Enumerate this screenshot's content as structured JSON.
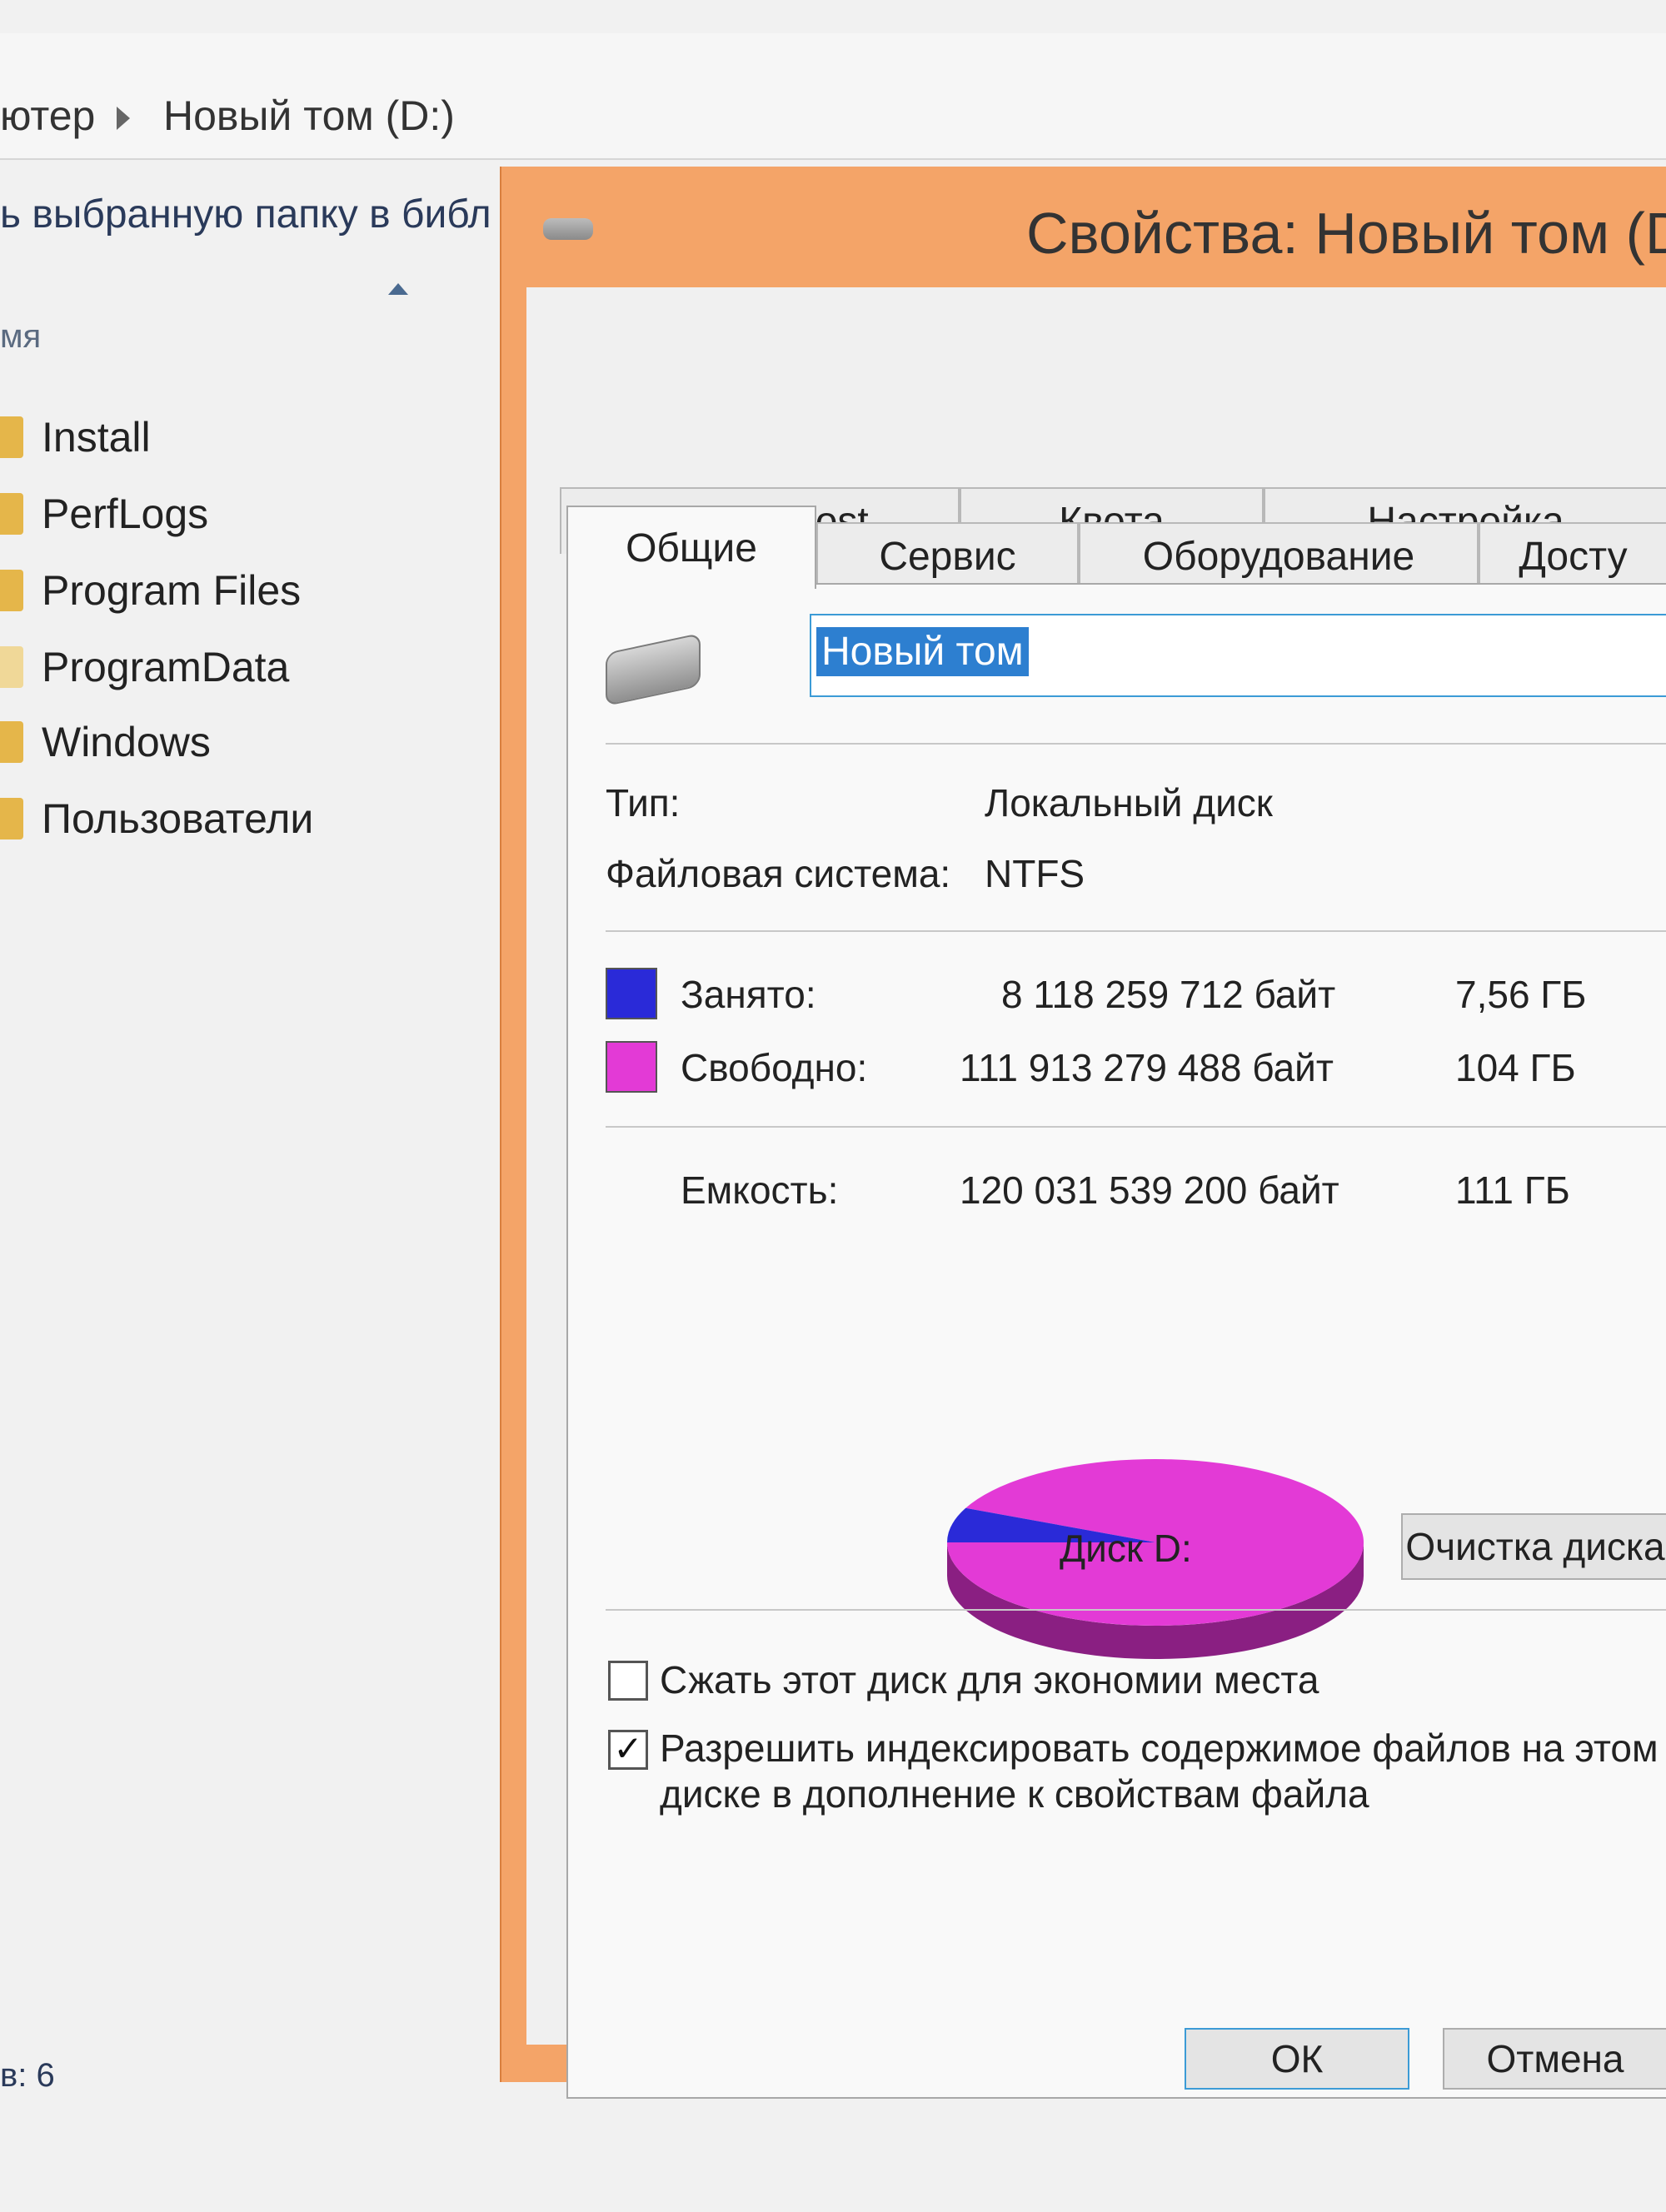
{
  "explorer": {
    "breadcrumb": {
      "part1": "ютер",
      "part2": "Новый том (D:)"
    },
    "toolbar_text": "ь выбранную папку в библ",
    "column_header": "мя",
    "files": [
      "Install",
      "PerfLogs",
      "Program Files",
      "ProgramData",
      "Windows",
      "Пользователи"
    ],
    "status_text": "в: 6"
  },
  "dialog": {
    "title": "Свойства: Новый том (D",
    "tabs_row1": [
      "ReadyBoost",
      "Квота",
      "Настройка"
    ],
    "tabs_row2": [
      "Общие",
      "Сервис",
      "Оборудование",
      "Досту"
    ],
    "active_tab": "Общие",
    "volume_name": "Новый том",
    "type_label": "Тип:",
    "type_value": "Локальный диск",
    "fs_label": "Файловая система:",
    "fs_value": "NTFS",
    "used_label": "Занято:",
    "used_bytes": "8 118 259 712 байт",
    "used_gb": "7,56 ГБ",
    "free_label": "Свободно:",
    "free_bytes": "111 913 279 488 байт",
    "free_gb": "104 ГБ",
    "capacity_label": "Емкость:",
    "capacity_bytes": "120 031 539 200 байт",
    "capacity_gb": "111 ГБ",
    "disk_label": "Диск D:",
    "cleanup_button": "Очистка диска",
    "compress_label": "Сжать этот диск для экономии места",
    "compress_checked": false,
    "index_label_line1": "Разрешить индексировать содержимое файлов на этом",
    "index_label_line2": "диске в дополнение к свойствам файла",
    "index_checked": true,
    "ok_button": "ОК",
    "cancel_button": "Отмена",
    "colors": {
      "used": "#2a2ad8",
      "free": "#e33ad6",
      "accent": "#f4a468"
    }
  },
  "chart_data": {
    "type": "pie",
    "categories": [
      "Занято",
      "Свободно"
    ],
    "values": [
      8118259712,
      111913279488
    ]
  }
}
